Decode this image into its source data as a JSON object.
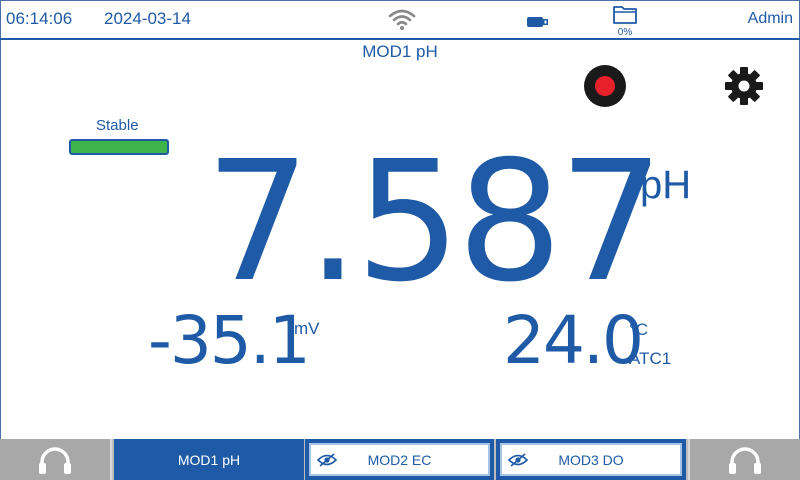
{
  "status_bar": {
    "time": "06:14:06",
    "date": "2024-03-14",
    "icons": [
      "wifi-icon",
      "usb-icon",
      "folder-icon"
    ],
    "storage_usage": "0%",
    "user": "Admin"
  },
  "module_title": "MOD1 pH",
  "stability": {
    "label": "Stable",
    "color": "#3cb44b"
  },
  "reading": {
    "value": "7.587",
    "unit": "pH"
  },
  "mv_reading": {
    "value": "-35.1",
    "unit": "mV"
  },
  "temperature": {
    "value": "24.0",
    "unit": "°C",
    "sensor": "ATC1"
  },
  "controls": [
    "record-button",
    "settings-button"
  ],
  "tabs": [
    {
      "label": "MOD1 pH",
      "active": true
    },
    {
      "label": "MOD2 EC",
      "active": false,
      "icon": "eye-icon"
    },
    {
      "label": "MOD3 DO",
      "active": false,
      "icon": "eye-icon"
    }
  ],
  "colors": {
    "accent": "#1f5aa6",
    "record": "#e8202a",
    "tab_bar": "#bcbcbc"
  }
}
